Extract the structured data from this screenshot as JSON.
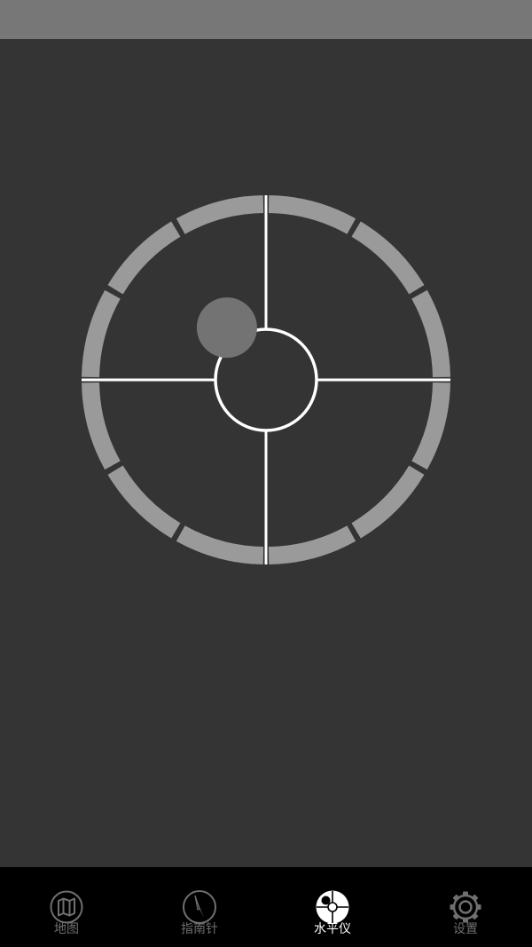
{
  "level": {
    "bubble_offset_x": -0.29,
    "bubble_offset_y": -0.29,
    "ring_color": "#9a9a9a",
    "line_color": "#ffffff",
    "bubble_color": "#737373"
  },
  "colors": {
    "status_bar": "#777777",
    "background": "#343434",
    "tab_bar": "#000000",
    "tab_inactive": "#6f6f6f",
    "tab_active": "#ffffff"
  },
  "tabs": [
    {
      "label": "地图",
      "icon": "map-icon",
      "active": false
    },
    {
      "label": "指南针",
      "icon": "compass-icon",
      "active": false
    },
    {
      "label": "水平仪",
      "icon": "spirit-level-icon",
      "active": true
    },
    {
      "label": "设置",
      "icon": "gear-icon",
      "active": false
    }
  ]
}
